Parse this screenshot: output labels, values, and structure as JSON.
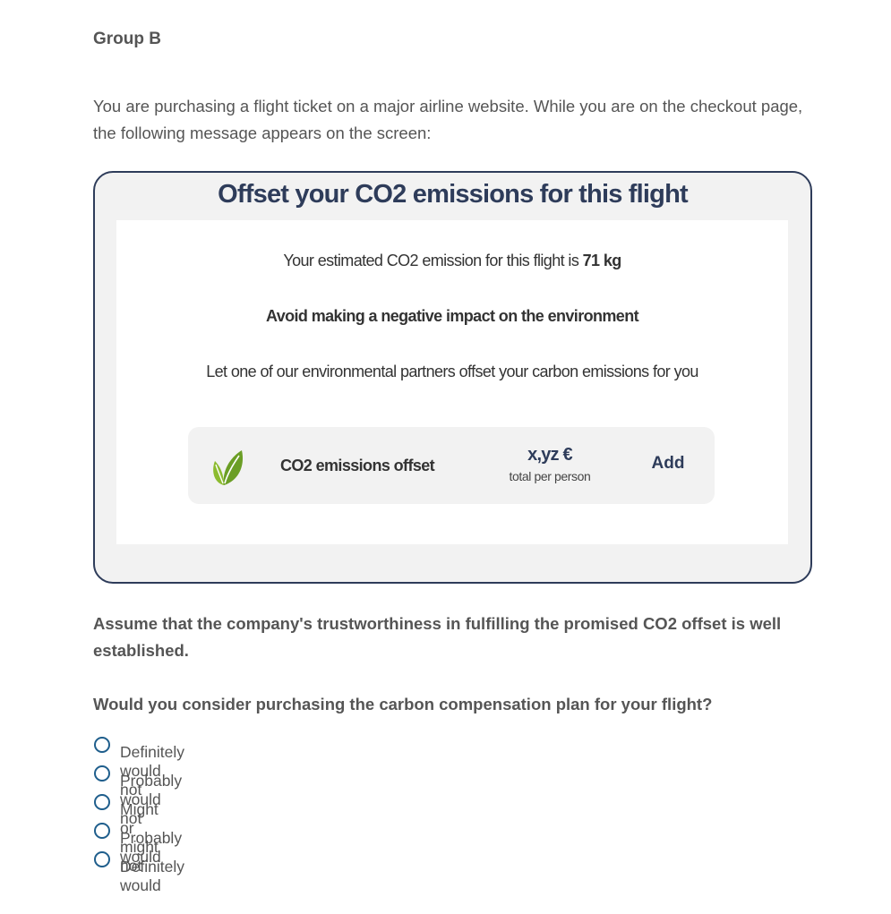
{
  "group_title": "Group B",
  "intro": "You are purchasing a flight ticket on a major airline website. While you are on the checkout page, the following message appears on the screen:",
  "card": {
    "title": "Offset your CO2 emissions for this flight",
    "estimate_prefix": "Your estimated CO2 emission for this flight is ",
    "estimate_value": "71 kg",
    "tagline": "Avoid making a negative impact on the environment",
    "partners_text": "Let one of our environmental partners offset your carbon emissions for you",
    "offer": {
      "icon": "leaf-icon",
      "label": "CO2 emissions offset",
      "price": "x,yz €",
      "price_note": "total per person",
      "add_label": "Add"
    },
    "colors": {
      "border": "#2e3c5a",
      "title": "#2e3c5a",
      "background": "#f2f2f2",
      "leaf": "#7aab2a"
    }
  },
  "assume_text": "Assume that the company's trustworthiness in fulfilling the promised CO2 offset is well established.",
  "question": "Would you consider purchasing the carbon compensation plan for your flight?",
  "options": [
    "Definitely would not",
    "Probably would not",
    "Might or might not",
    "Probably would",
    "Definitely would"
  ],
  "radio_color": "#1f5e8c"
}
